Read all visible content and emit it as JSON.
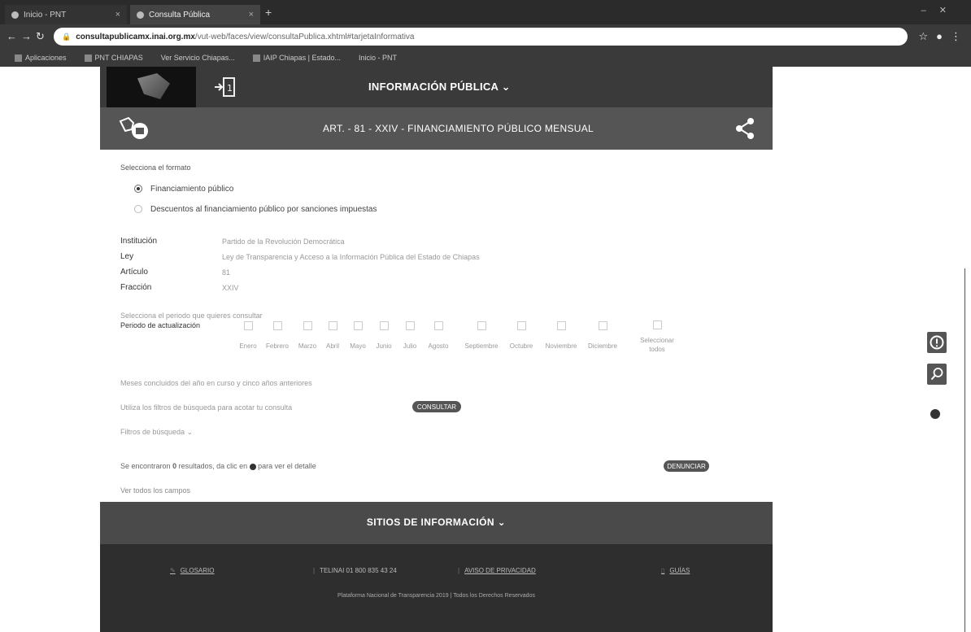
{
  "browser": {
    "tabs": [
      {
        "label": "Inicio - PNT"
      },
      {
        "label": "Consulta Pública"
      }
    ],
    "url_host": "consultapublicamx.inai.org.mx",
    "url_path": "/vut-web/faces/view/consultaPublica.xhtml#tarjetaInformativa",
    "bookmarks": [
      "Aplicaciones",
      "PNT CHIAPAS",
      "Ver Servicio Chiapas...",
      "IAIP Chiapas | Estado...",
      "Inicio - PNT"
    ]
  },
  "header": {
    "menu_label": "INFORMACIÓN PÚBLICA ⌄",
    "article_title": "ART. - 81 - XXIV - FINANCIAMIENTO PÚBLICO MENSUAL"
  },
  "format": {
    "prompt": "Selecciona el formato",
    "options": [
      {
        "label": "Financiamiento público",
        "selected": true
      },
      {
        "label": "Descuentos al financiamiento público por sanciones impuestas",
        "selected": false
      }
    ]
  },
  "info": [
    {
      "key": "Institución",
      "value": "Partido de la Revolución Democrática"
    },
    {
      "key": "Ley",
      "value": "Ley de Transparencia y Acceso a la Información Pública del Estado de Chiapas"
    },
    {
      "key": "Artículo",
      "value": "81"
    },
    {
      "key": "Fracción",
      "value": "XXIV"
    }
  ],
  "period": {
    "prompt": "Selecciona el periodo que quieres consultar",
    "label": "Periodo de actualización",
    "months": [
      "Enero",
      "Febrero",
      "Marzo",
      "Abril",
      "Mayo",
      "Junio",
      "Julio",
      "Agosto",
      "Septiembre",
      "Octubre",
      "Noviembre",
      "Diciembre"
    ],
    "select_all": [
      "Seleccionar",
      "todos"
    ],
    "note": "Meses concluidos del año en curso y cinco años anteriores"
  },
  "search": {
    "hint": "Utiliza los filtros de búsqueda para acotar tu consulta",
    "consult_button": "CONSULTAR",
    "filters_label": "Filtros de búsqueda ⌄"
  },
  "results": {
    "text_before": "Se encontraron",
    "count": "0",
    "text_after": "resultados, da clic en",
    "text_end": "para ver el detalle",
    "report_button": "DENUNCIAR",
    "all_fields": "Ver todos los campos"
  },
  "footer": {
    "title": "SITIOS DE INFORMACIÓN ⌄",
    "links": [
      {
        "label": "GLOSARIO"
      },
      {
        "label": "TELINAI 01 800 835 43 24"
      },
      {
        "label": "AVISO DE PRIVACIDAD"
      },
      {
        "label": "GUÍAS"
      }
    ],
    "copyright": "Plataforma Nacional de Transparencia 2019 | Todos los Derechos Reservados"
  }
}
